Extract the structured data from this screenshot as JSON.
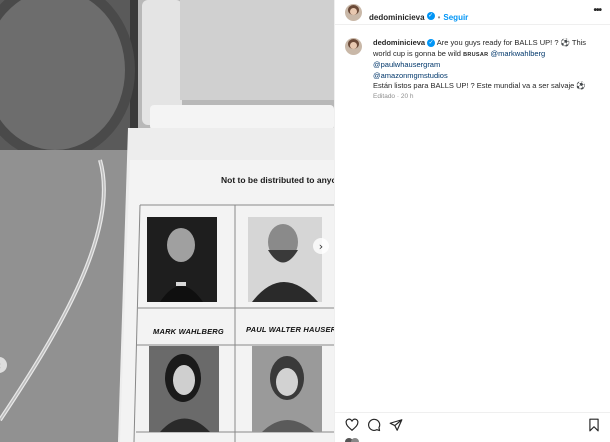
{
  "post": {
    "username": "dedominicieva",
    "follow_label": "Seguir",
    "more_label": "•••",
    "caption_text_1": "Are you guys ready for BALLS UP! ? ⚽ This world cup is gonna be wild",
    "caption_brusar": "BRUSAR",
    "mention_1": "@markwahlberg",
    "mention_2": "@paulwhausergram",
    "mention_3": "@amazonmgmstudios",
    "caption_text_2": "Están listos para BALLS UP! ? Este mundial va a ser salvaje ⚽",
    "edited_label": "Editado",
    "time_ago": "20 h"
  },
  "media": {
    "paper_header": "Not to be distributed to anyon",
    "caption_left": "MARK WAHLBERG",
    "caption_right": "PAUL WALTER HAUSER",
    "next_icon": "›",
    "prev_icon": "‹"
  },
  "actions": {
    "like_icon": "heart-icon",
    "comment_icon": "comment-icon",
    "share_icon": "share-icon",
    "save_icon": "bookmark-icon"
  }
}
